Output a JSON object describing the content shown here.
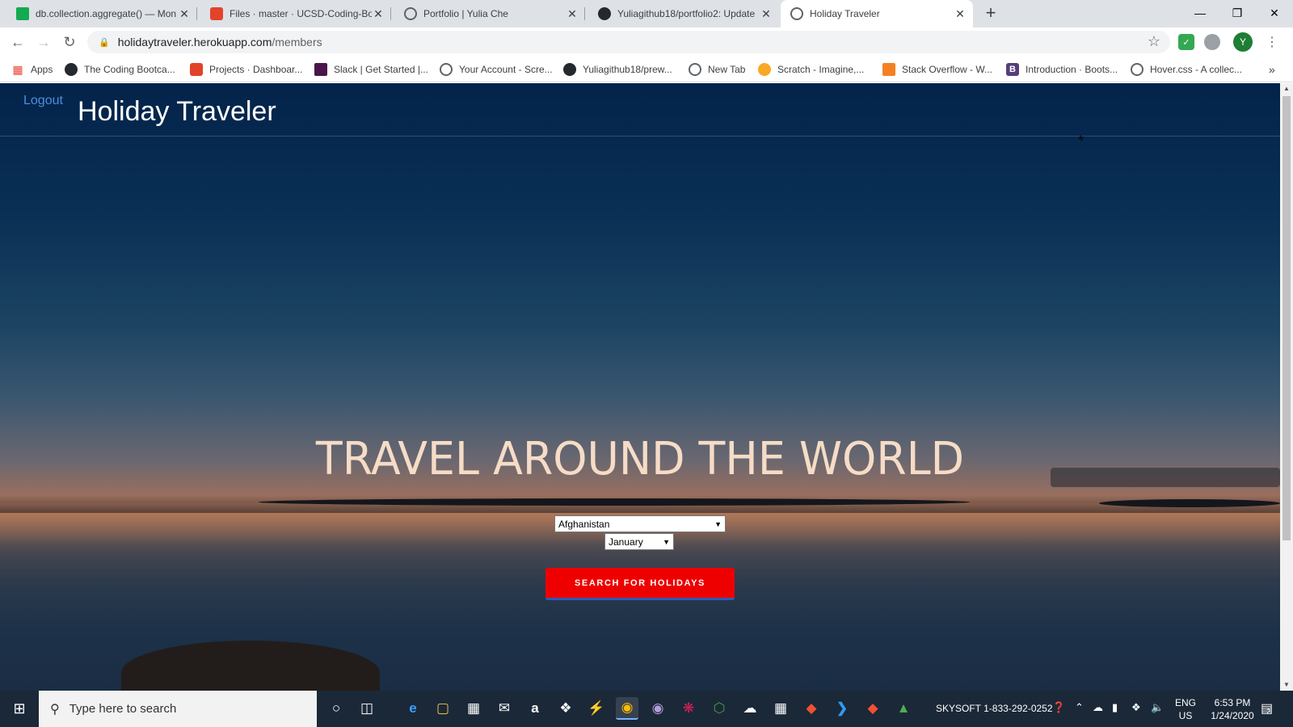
{
  "browser": {
    "tabs": [
      {
        "title": "db.collection.aggregate() — Mon",
        "icon": "mongodb-leaf-icon",
        "color": "#13aa52"
      },
      {
        "title": "Files · master · UCSD-Coding-Boc",
        "icon": "gitlab-fox-icon",
        "color": "#e24329"
      },
      {
        "title": "Portfolio | Yulia Che",
        "icon": "globe-icon",
        "color": "#5f6368"
      },
      {
        "title": "Yuliagithub18/portfolio2: Update",
        "icon": "github-icon",
        "color": "#24292e"
      },
      {
        "title": "Holiday Traveler",
        "icon": "globe-icon",
        "color": "#5f6368"
      }
    ],
    "new_tab_symbol": "+",
    "address": {
      "host": "holidaytraveler.herokuapp.com",
      "path": "/members"
    },
    "profile_initial": "Y",
    "bookmarks": [
      {
        "label": "Apps",
        "icon": "apps-grid-icon"
      },
      {
        "label": "The Coding Bootca...",
        "icon": "github-icon"
      },
      {
        "label": "Projects · Dashboar...",
        "icon": "gitlab-fox-icon"
      },
      {
        "label": "Slack | Get Started |...",
        "icon": "slack-icon"
      },
      {
        "label": "Your Account - Scre...",
        "icon": "globe-icon"
      },
      {
        "label": "Yuliagithub18/prew...",
        "icon": "github-icon"
      },
      {
        "label": "New Tab",
        "icon": "globe-icon"
      },
      {
        "label": "Scratch - Imagine,...",
        "icon": "scratch-icon"
      },
      {
        "label": "Stack Overflow - W...",
        "icon": "stackoverflow-icon"
      },
      {
        "label": "Introduction · Boots...",
        "icon": "bootstrap-icon"
      },
      {
        "label": "Hover.css - A collec...",
        "icon": "globe-icon"
      }
    ]
  },
  "page": {
    "logout_label": "Logout",
    "brand": "Holiday Traveler",
    "headline": "TRAVEL AROUND THE WORLD",
    "country_select": {
      "selected": "Afghanistan"
    },
    "month_select": {
      "selected": "January"
    },
    "search_button": "SEARCH FOR HOLIDAYS",
    "button_color": "#ee0000"
  },
  "taskbar": {
    "search_placeholder": "Type here to search",
    "tray_label": "SKYSOFT 1-833-292-0252",
    "language": {
      "line1": "ENG",
      "line2": "US"
    },
    "time": "6:53 PM",
    "date": "1/24/2020",
    "notifications": "2"
  }
}
